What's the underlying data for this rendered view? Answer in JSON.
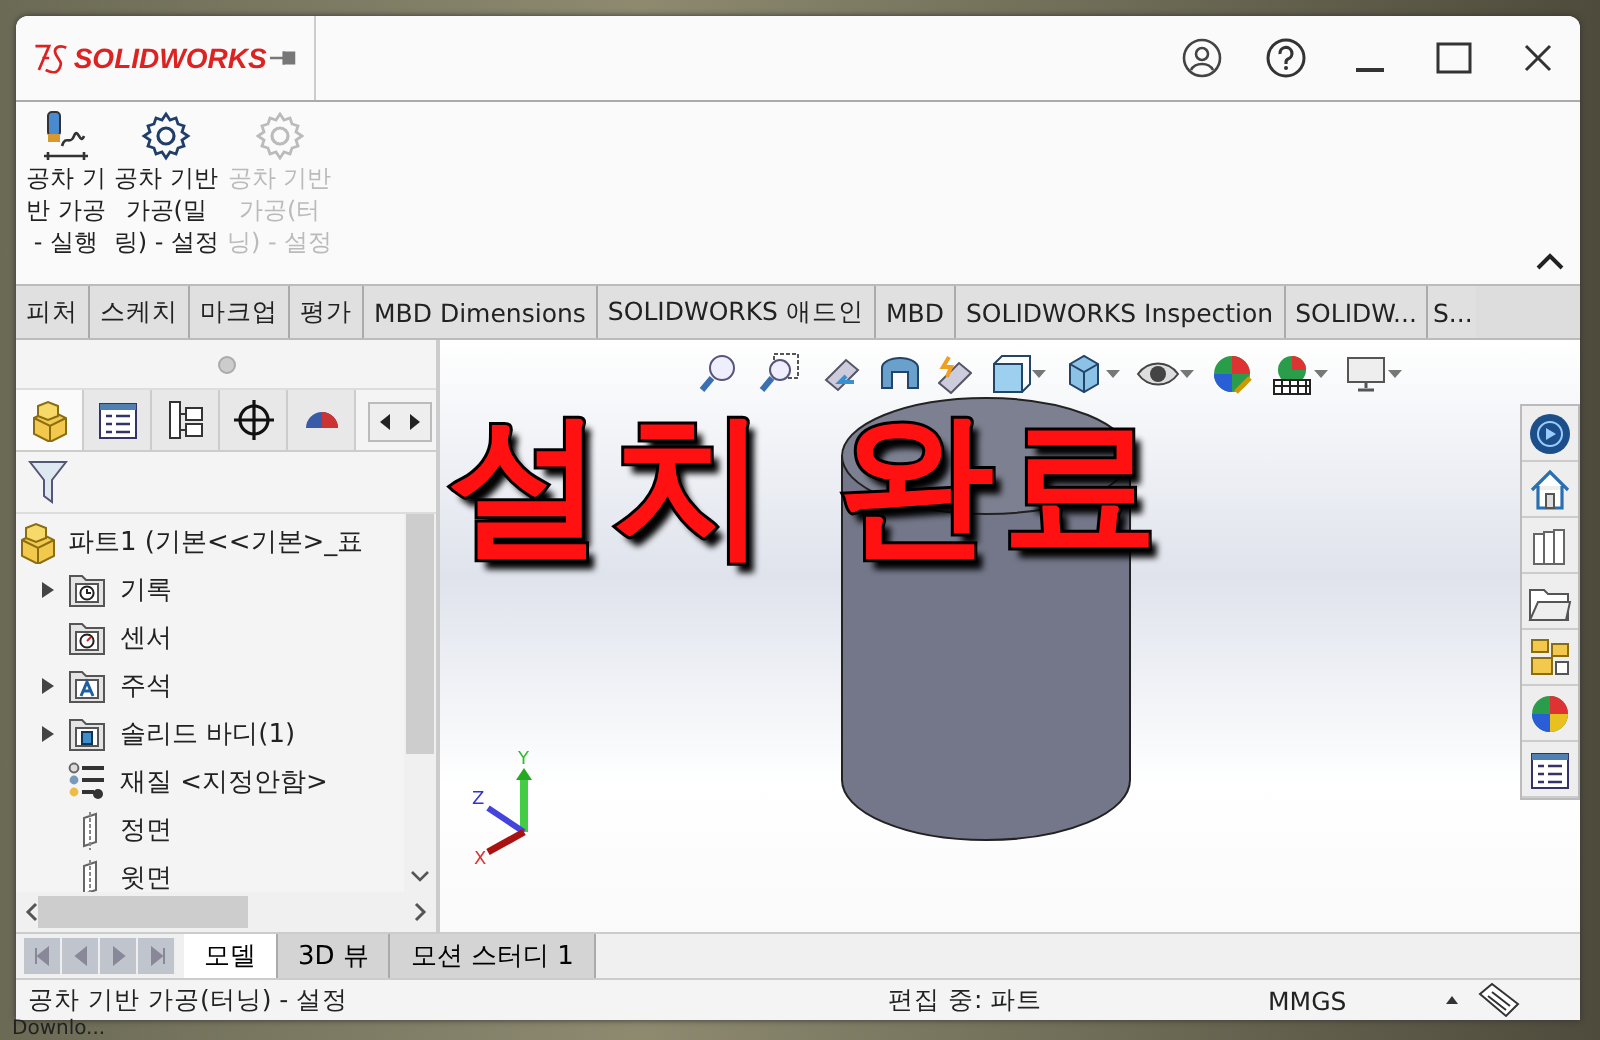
{
  "window": {
    "logo": "SOLIDWORKS"
  },
  "ribbon": {
    "buttons": [
      {
        "label": "공차 기\n반 가공\n- 실행",
        "kind": "tool",
        "disabled": false
      },
      {
        "label": "공차 기반\n가공(밀\n링) - 설정",
        "kind": "gear",
        "disabled": false
      },
      {
        "label": "공차 기반\n가공(터\n닝) - 설정",
        "kind": "gear",
        "disabled": true
      }
    ]
  },
  "command_tabs": [
    {
      "label": "피처",
      "selected": false
    },
    {
      "label": "스케치",
      "selected": false
    },
    {
      "label": "마크업",
      "selected": false
    },
    {
      "label": "평가",
      "selected": false
    },
    {
      "label": "MBD Dimensions",
      "selected": false
    },
    {
      "label": "SOLIDWORKS 애드인",
      "selected": false
    },
    {
      "label": "MBD",
      "selected": false
    },
    {
      "label": "SOLIDWORKS Inspection",
      "selected": false
    },
    {
      "label": "SOLIDW...",
      "selected": false
    },
    {
      "label": "S...",
      "selected": false
    }
  ],
  "panel_tabs": [
    {
      "kind": "feature",
      "selected": true
    },
    {
      "kind": "property",
      "selected": false
    },
    {
      "kind": "config",
      "selected": false
    },
    {
      "kind": "dimxpert",
      "selected": false
    },
    {
      "kind": "display",
      "selected": false
    }
  ],
  "tree": {
    "label": "파트1  (기본<<기본>_표",
    "kind": "part",
    "children": [
      {
        "label": "기록",
        "kind": "history",
        "expandable": true
      },
      {
        "label": "센서",
        "kind": "sensor",
        "expandable": false
      },
      {
        "label": "주석",
        "kind": "annotation",
        "expandable": true
      },
      {
        "label": "솔리드 바디(1)",
        "kind": "body",
        "expandable": true
      },
      {
        "label": "재질 <지정안함>",
        "kind": "material",
        "expandable": false
      },
      {
        "label": "정면",
        "kind": "plane",
        "expandable": false
      },
      {
        "label": "윗면",
        "kind": "plane",
        "expandable": false
      }
    ]
  },
  "viewport": {
    "axes": [
      "X",
      "Y",
      "Z"
    ]
  },
  "overlay_caption": "설치 완료",
  "bottom_tabs": [
    {
      "label": "모델",
      "selected": true
    },
    {
      "label": "3D 뷰",
      "selected": false
    },
    {
      "label": "모션 스터디 1",
      "selected": false
    }
  ],
  "status_bar": {
    "message": "공차 기반 가공(터닝) - 설정",
    "mode": "편집 중: 파트",
    "units": "MMGS"
  },
  "desktop_label": "Downlo..."
}
